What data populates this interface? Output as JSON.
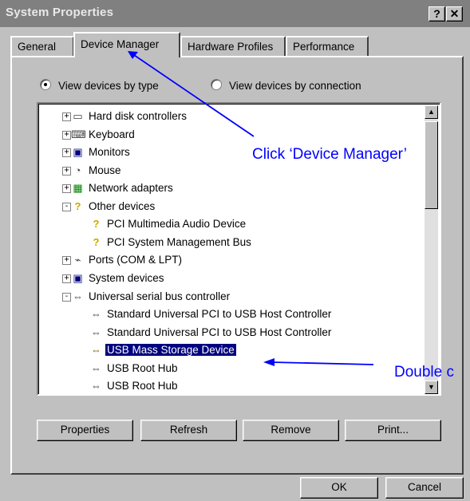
{
  "window": {
    "title": "System Properties",
    "help_label": "?",
    "close_label": "✕"
  },
  "tabs": [
    {
      "label": "General",
      "active": false
    },
    {
      "label": "Device Manager",
      "active": true
    },
    {
      "label": "Hardware Profiles",
      "active": false
    },
    {
      "label": "Performance",
      "active": false
    }
  ],
  "view_options": [
    {
      "label": "View devices by type",
      "selected": true
    },
    {
      "label": "View devices by connection",
      "selected": false
    }
  ],
  "device_tree": [
    {
      "label": "Hard disk controllers",
      "icon": "hard-disk-icon",
      "expander": "+"
    },
    {
      "label": "Keyboard",
      "icon": "keyboard-icon",
      "expander": "+"
    },
    {
      "label": "Monitors",
      "icon": "monitor-icon",
      "expander": "+"
    },
    {
      "label": "Mouse",
      "icon": "mouse-icon",
      "expander": "+"
    },
    {
      "label": "Network adapters",
      "icon": "network-adapter-icon",
      "expander": "+"
    },
    {
      "label": "Other devices",
      "icon": "question-mark-icon",
      "expander": "-"
    },
    {
      "label": "PCI Multimedia Audio Device",
      "icon": "unknown-device-icon"
    },
    {
      "label": "PCI System Management Bus",
      "icon": "unknown-device-icon"
    },
    {
      "label": "Ports (COM & LPT)",
      "icon": "port-icon",
      "expander": "+"
    },
    {
      "label": "System devices",
      "icon": "computer-icon",
      "expander": "+"
    },
    {
      "label": "Universal serial bus controller",
      "icon": "usb-icon",
      "expander": "-"
    },
    {
      "label": "Standard Universal PCI to USB Host Controller",
      "icon": "usb-icon"
    },
    {
      "label": "Standard Universal PCI to USB Host Controller",
      "icon": "usb-icon"
    },
    {
      "label": "USB Mass Storage Device",
      "icon": "usb-warning-icon",
      "selected": true
    },
    {
      "label": "USB Root Hub",
      "icon": "usb-icon"
    },
    {
      "label": "USB Root Hub",
      "icon": "usb-icon"
    }
  ],
  "action_buttons": {
    "properties": "Properties",
    "refresh": "Refresh",
    "remove": "Remove",
    "print": "Print..."
  },
  "dialog_buttons": {
    "ok": "OK",
    "cancel": "Cancel"
  },
  "annotations": {
    "device_manager_hint": "Click ‘Device Manager’",
    "double_click_hint": "Double c"
  },
  "colors": {
    "title_bar": "#808080",
    "face": "#c0c0c0",
    "selection": "#000080",
    "annotation": "#0000ff"
  }
}
